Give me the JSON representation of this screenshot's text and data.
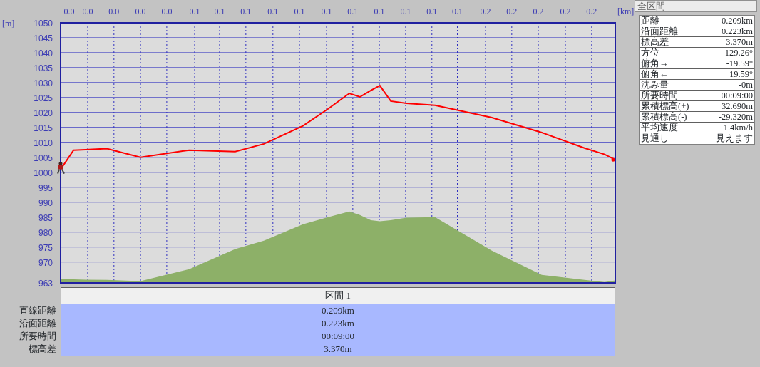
{
  "chart": {
    "chart_data": {
      "type": "line",
      "xlabel": "[km]",
      "ylabel": "[m]",
      "x": [
        0,
        0.0049,
        0.0094,
        0.0174,
        0.0301,
        0.0484,
        0.0658,
        0.0766,
        0.0913,
        0.1008,
        0.1088,
        0.1128,
        0.1169,
        0.1203,
        0.1244,
        0.1303,
        0.1411,
        0.1625,
        0.1813,
        0.1974,
        0.205,
        0.209
      ],
      "series": [
        {
          "type": "line",
          "color": "#ff0000",
          "values": [
            1001.0,
            1007.4,
            1007.6,
            1007.9,
            1005.0,
            1007.4,
            1006.9,
            1009.5,
            1015.5,
            1021.2,
            1026.4,
            1025.2,
            1027.4,
            1029.0,
            1023.8,
            1023.1,
            1022.4,
            1018.3,
            1013.3,
            1008.1,
            1006.0,
            1004.2
          ]
        },
        {
          "type": "area",
          "color": "#8db068",
          "values": [
            964.3,
            964.2,
            964.1,
            964.0,
            963.6,
            967.6,
            974.3,
            977.1,
            982.6,
            985.0,
            986.9,
            985.7,
            984.0,
            983.6,
            984.0,
            984.8,
            985.0,
            973.8,
            965.7,
            964.0,
            963.3,
            963.8
          ]
        }
      ],
      "grid": true,
      "xlim": [
        0,
        0.209
      ],
      "ylim": [
        963,
        1050
      ],
      "xticks": [
        {
          "value": 0.0032,
          "label": "0.0"
        },
        {
          "value": 0.0102,
          "label": "0.0"
        },
        {
          "value": 0.0201,
          "label": "0.0"
        },
        {
          "value": 0.0301,
          "label": "0.0"
        },
        {
          "value": 0.04,
          "label": "0.0"
        },
        {
          "value": 0.0505,
          "label": "0.1"
        },
        {
          "value": 0.0599,
          "label": "0.1"
        },
        {
          "value": 0.0698,
          "label": "0.1"
        },
        {
          "value": 0.08,
          "label": "0.1"
        },
        {
          "value": 0.09,
          "label": "0.1"
        },
        {
          "value": 0.1002,
          "label": "0.1"
        },
        {
          "value": 0.1101,
          "label": "0.1"
        },
        {
          "value": 0.1201,
          "label": "0.1"
        },
        {
          "value": 0.13,
          "label": "0.1"
        },
        {
          "value": 0.1399,
          "label": "0.1"
        },
        {
          "value": 0.1495,
          "label": "0.1"
        },
        {
          "value": 0.1601,
          "label": "0.2"
        },
        {
          "value": 0.17,
          "label": "0.2"
        },
        {
          "value": 0.18,
          "label": "0.2"
        },
        {
          "value": 0.1902,
          "label": "0.2"
        },
        {
          "value": 0.2001,
          "label": "0.2"
        }
      ],
      "yticks": [
        963,
        970,
        975,
        980,
        985,
        990,
        995,
        1000,
        1005,
        1010,
        1015,
        1020,
        1025,
        1030,
        1035,
        1040,
        1045,
        1050
      ]
    }
  },
  "sections": {
    "header": "区間 1",
    "rows": [
      {
        "label": "直線距離",
        "value": "0.209km"
      },
      {
        "label": "沿面距離",
        "value": "0.223km"
      },
      {
        "label": "所要時間",
        "value": "00:09:00"
      },
      {
        "label": "標高差",
        "value": "3.370m"
      }
    ]
  },
  "summary": {
    "title": "全区間",
    "rows": [
      {
        "label": "距離",
        "value": "0.209km"
      },
      {
        "label": "沿面距離",
        "value": "0.223km"
      },
      {
        "label": "標高差",
        "value": "3.370m"
      },
      {
        "label": "方位",
        "value": "129.26°"
      },
      {
        "label": "俯角→",
        "value": "-19.59°"
      },
      {
        "label": "俯角←",
        "value": "19.59°"
      },
      {
        "label": "沈み量",
        "value": "-0m"
      },
      {
        "label": "所要時間",
        "value": "00:09:00"
      },
      {
        "label": "累積標高(+)",
        "value": "32.690m"
      },
      {
        "label": "累積標高(-)",
        "value": "-29.320m"
      },
      {
        "label": "平均速度",
        "value": "1.4km/h"
      },
      {
        "label": "見通し",
        "value": "見えます"
      }
    ]
  }
}
